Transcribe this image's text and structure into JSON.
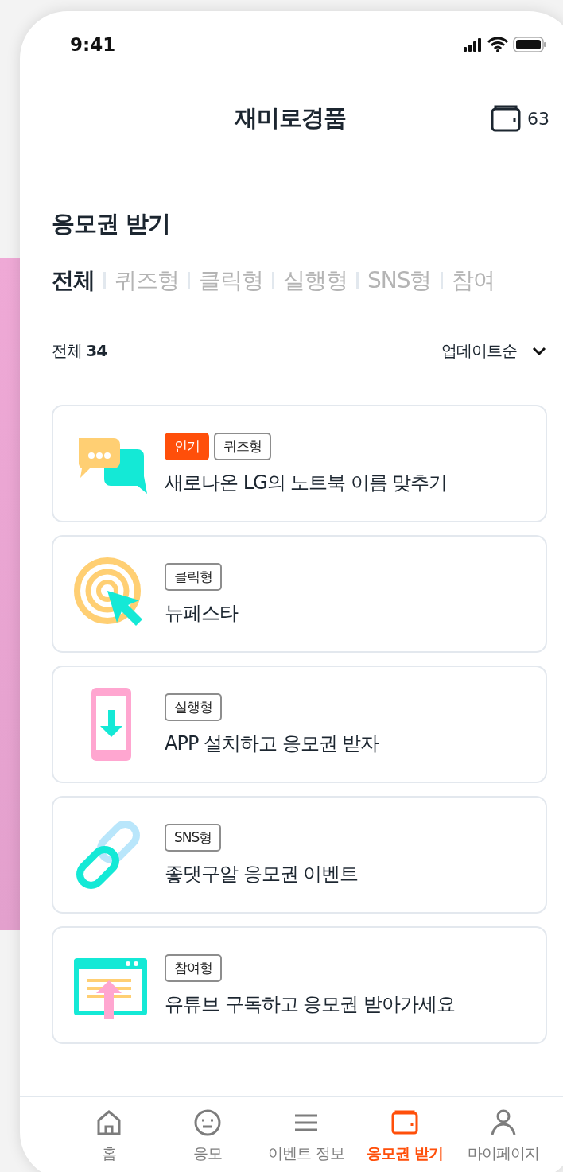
{
  "status_bar": {
    "time": "9:41"
  },
  "header": {
    "title": "재미로경품",
    "wallet_count": "63"
  },
  "section": {
    "title": "응모권 받기"
  },
  "tabs": [
    {
      "label": "전체",
      "selected": true
    },
    {
      "label": "퀴즈형",
      "selected": false
    },
    {
      "label": "클릭형",
      "selected": false
    },
    {
      "label": "실행형",
      "selected": false
    },
    {
      "label": "SNS형",
      "selected": false
    },
    {
      "label": "참여",
      "selected": false
    }
  ],
  "summary": {
    "label": "전체",
    "count": "34",
    "sort": "업데이트순"
  },
  "events": [
    {
      "kind": "quiz",
      "badges": [
        {
          "kind": "hot",
          "label": "인기"
        },
        {
          "kind": "type",
          "label": "퀴즈형"
        }
      ],
      "title": "새로나온 LG의 노트북 이름 맞추기"
    },
    {
      "kind": "click",
      "badges": [
        {
          "kind": "type",
          "label": "클릭형"
        }
      ],
      "title": "뉴페스타"
    },
    {
      "kind": "app",
      "badges": [
        {
          "kind": "type",
          "label": "실행형"
        }
      ],
      "title": "APP 설치하고 응모권 받자"
    },
    {
      "kind": "sns",
      "badges": [
        {
          "kind": "type",
          "label": "SNS형"
        }
      ],
      "title": "좋댓구알 응모권 이벤트"
    },
    {
      "kind": "join",
      "badges": [
        {
          "kind": "type",
          "label": "참여형"
        }
      ],
      "title": "유튜브 구독하고 응모권 받아가세요"
    }
  ],
  "bottom_nav": [
    {
      "kind": "home",
      "label": "홈",
      "selected": false
    },
    {
      "kind": "face",
      "label": "응모",
      "selected": false
    },
    {
      "kind": "list",
      "label": "이벤트 정보",
      "selected": false
    },
    {
      "kind": "wallet",
      "label": "응모권 받기",
      "selected": true
    },
    {
      "kind": "person",
      "label": "마이페이지",
      "selected": false
    }
  ]
}
